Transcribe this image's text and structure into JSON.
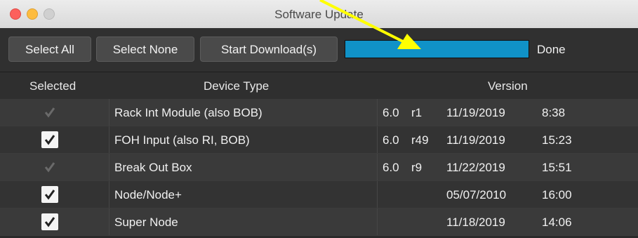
{
  "window": {
    "title": "Software Update"
  },
  "toolbar": {
    "select_all": "Select All",
    "select_none": "Select None",
    "start_download": "Start Download(s)",
    "progress_percent": 100,
    "status": "Done"
  },
  "table": {
    "headers": {
      "selected": "Selected",
      "device_type": "Device Type",
      "version": "Version"
    },
    "rows": [
      {
        "selected": false,
        "device": "Rack Int Module (also BOB)",
        "version": "6.0",
        "rev": "r1",
        "date": "11/19/2019",
        "time": "8:38"
      },
      {
        "selected": true,
        "device": "FOH Input (also RI, BOB)",
        "version": "6.0",
        "rev": "r49",
        "date": "11/19/2019",
        "time": "15:23"
      },
      {
        "selected": false,
        "device": "Break Out Box",
        "version": "6.0",
        "rev": "r9",
        "date": "11/22/2019",
        "time": "15:51"
      },
      {
        "selected": true,
        "device": "Node/Node+",
        "version": "",
        "rev": "",
        "date": "05/07/2010",
        "time": "16:00"
      },
      {
        "selected": true,
        "device": "Super Node",
        "version": "",
        "rev": "",
        "date": "11/18/2019",
        "time": "14:06"
      }
    ]
  },
  "colors": {
    "progress": "#1092c7",
    "annotation_arrow": "#ffff00"
  }
}
